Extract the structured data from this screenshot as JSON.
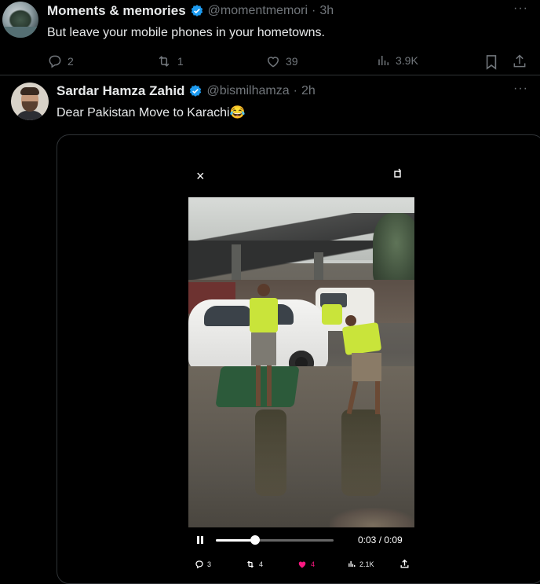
{
  "tweet1": {
    "display_name": "Moments & memories",
    "handle": "@momentmemori",
    "separator": "·",
    "time": "3h",
    "text": "But leave your mobile phones in your hometowns.",
    "actions": {
      "replies": "2",
      "reposts": "1",
      "likes": "39",
      "views": "3.9K"
    }
  },
  "tweet2": {
    "display_name": "Sardar Hamza Zahid",
    "handle": "@bismilhamza",
    "separator": "·",
    "time": "2h",
    "text": "Dear Pakistan Move to Karachi",
    "emoji": "😂",
    "video": {
      "close_glyph": "×",
      "current_time": "0:03",
      "duration": "0:09",
      "time_separator": " / ",
      "progress_fraction": 0.33,
      "actions": {
        "replies": "3",
        "reposts": "4",
        "likes": "4",
        "views": "2.1K"
      }
    }
  },
  "more_glyph": "···",
  "colors": {
    "verified": "#1d9bf0",
    "muted": "#71767b",
    "like_active": "#f91880"
  },
  "icons": [
    "verified-badge-icon",
    "reply-icon",
    "repost-icon",
    "like-icon",
    "views-icon",
    "bookmark-icon",
    "share-icon",
    "close-icon",
    "rotate-icon",
    "pause-icon"
  ]
}
